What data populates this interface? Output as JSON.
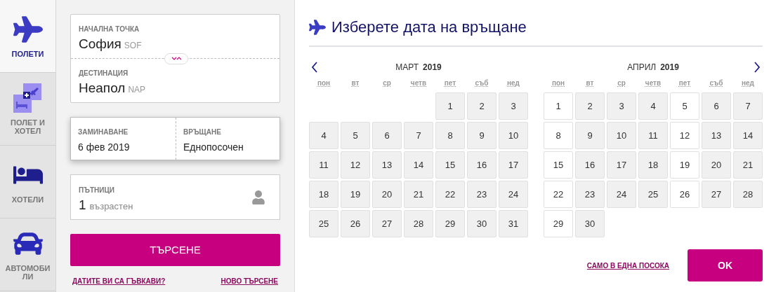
{
  "sidebar": {
    "items": [
      {
        "kind": "flights",
        "label": "ПОЛЕТИ",
        "selected": true
      },
      {
        "kind": "flight_hotel",
        "label": "ПОЛЕТ И ХОТЕЛ",
        "selected": false
      },
      {
        "kind": "hotels",
        "label": "ХОТЕЛИ",
        "selected": false
      },
      {
        "kind": "cars",
        "label": "АВТОМОБИ ЛИ",
        "selected": false
      }
    ]
  },
  "search_form": {
    "origin": {
      "label": "НАЧАЛНА ТОЧКА",
      "city": "София",
      "code": "SOF"
    },
    "destination": {
      "label": "ДЕСТИНАЦИЯ",
      "city": "Неапол",
      "code": "NAP"
    },
    "departure": {
      "label": "ЗАМИНАВАНЕ",
      "value": "6 фев 2019"
    },
    "return": {
      "label": "ВРЪЩАНЕ",
      "value": "Еднопосочен"
    },
    "passengers": {
      "label": "ПЪТНИЦИ",
      "count": "1",
      "type": "възрастен"
    },
    "search_button": "ТЪРСЕНЕ",
    "links": [
      "ДАТИТЕ ВИ СА ГЪВКАВИ?",
      "НОВО ТЪРСЕНЕ"
    ]
  },
  "calendar": {
    "title": "Изберете дата на връщане",
    "months": [
      {
        "name": "МАРТ",
        "year": "2019",
        "weekdays": [
          "пон",
          "вт",
          "ср",
          "четв",
          "пет",
          "съб",
          "нед"
        ],
        "days": [
          {
            "kind": "blank"
          },
          {
            "kind": "blank"
          },
          {
            "kind": "blank"
          },
          {
            "kind": "blank"
          },
          {
            "kind": "day",
            "day": "1",
            "available": true
          },
          {
            "kind": "day",
            "day": "2",
            "available": true
          },
          {
            "kind": "day",
            "day": "3",
            "available": true
          },
          {
            "kind": "day",
            "day": "4",
            "available": true
          },
          {
            "kind": "day",
            "day": "5",
            "available": true
          },
          {
            "kind": "day",
            "day": "6",
            "available": true
          },
          {
            "kind": "day",
            "day": "7",
            "available": true
          },
          {
            "kind": "day",
            "day": "8",
            "available": true
          },
          {
            "kind": "day",
            "day": "9",
            "available": true
          },
          {
            "kind": "day",
            "day": "10",
            "available": true
          },
          {
            "kind": "day",
            "day": "11",
            "available": true
          },
          {
            "kind": "day",
            "day": "12",
            "available": true
          },
          {
            "kind": "day",
            "day": "13",
            "available": true
          },
          {
            "kind": "day",
            "day": "14",
            "available": true
          },
          {
            "kind": "day",
            "day": "15",
            "available": true
          },
          {
            "kind": "day",
            "day": "16",
            "available": true
          },
          {
            "kind": "day",
            "day": "17",
            "available": true
          },
          {
            "kind": "day",
            "day": "18",
            "available": true
          },
          {
            "kind": "day",
            "day": "19",
            "available": true
          },
          {
            "kind": "day",
            "day": "20",
            "available": true
          },
          {
            "kind": "day",
            "day": "21",
            "available": true
          },
          {
            "kind": "day",
            "day": "22",
            "available": true
          },
          {
            "kind": "day",
            "day": "23",
            "available": true
          },
          {
            "kind": "day",
            "day": "24",
            "available": true
          },
          {
            "kind": "day",
            "day": "25",
            "available": true
          },
          {
            "kind": "day",
            "day": "26",
            "available": true
          },
          {
            "kind": "day",
            "day": "27",
            "available": true
          },
          {
            "kind": "day",
            "day": "28",
            "available": true
          },
          {
            "kind": "day",
            "day": "29",
            "available": true
          },
          {
            "kind": "day",
            "day": "30",
            "available": true
          },
          {
            "kind": "day",
            "day": "31",
            "available": true
          }
        ]
      },
      {
        "name": "АПРИЛ",
        "year": "2019",
        "weekdays": [
          "пон",
          "вт",
          "ср",
          "четв",
          "пет",
          "съб",
          "нед"
        ],
        "days": [
          {
            "kind": "day",
            "day": "1",
            "available": false
          },
          {
            "kind": "day",
            "day": "2",
            "available": true
          },
          {
            "kind": "day",
            "day": "3",
            "available": true
          },
          {
            "kind": "day",
            "day": "4",
            "available": true
          },
          {
            "kind": "day",
            "day": "5",
            "available": false
          },
          {
            "kind": "day",
            "day": "6",
            "available": true
          },
          {
            "kind": "day",
            "day": "7",
            "available": true
          },
          {
            "kind": "day",
            "day": "8",
            "available": false
          },
          {
            "kind": "day",
            "day": "9",
            "available": true
          },
          {
            "kind": "day",
            "day": "10",
            "available": true
          },
          {
            "kind": "day",
            "day": "11",
            "available": true
          },
          {
            "kind": "day",
            "day": "12",
            "available": false
          },
          {
            "kind": "day",
            "day": "13",
            "available": true
          },
          {
            "kind": "day",
            "day": "14",
            "available": true
          },
          {
            "kind": "day",
            "day": "15",
            "available": false
          },
          {
            "kind": "day",
            "day": "16",
            "available": true
          },
          {
            "kind": "day",
            "day": "17",
            "available": true
          },
          {
            "kind": "day",
            "day": "18",
            "available": true
          },
          {
            "kind": "day",
            "day": "19",
            "available": false
          },
          {
            "kind": "day",
            "day": "20",
            "available": true
          },
          {
            "kind": "day",
            "day": "21",
            "available": true
          },
          {
            "kind": "day",
            "day": "22",
            "available": false
          },
          {
            "kind": "day",
            "day": "23",
            "available": true
          },
          {
            "kind": "day",
            "day": "24",
            "available": true
          },
          {
            "kind": "day",
            "day": "25",
            "available": true
          },
          {
            "kind": "day",
            "day": "26",
            "available": false
          },
          {
            "kind": "day",
            "day": "27",
            "available": true
          },
          {
            "kind": "day",
            "day": "28",
            "available": true
          },
          {
            "kind": "day",
            "day": "29",
            "available": false
          },
          {
            "kind": "day",
            "day": "30",
            "available": true
          }
        ]
      }
    ],
    "one_way_link": "САМО В ЕДНА ПОСОКА",
    "ok_button": "OK"
  }
}
